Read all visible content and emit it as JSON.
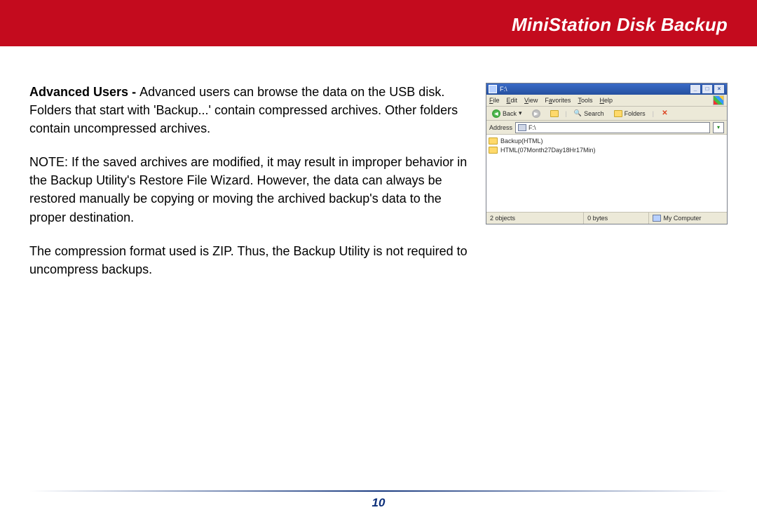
{
  "header": {
    "title": "MiniStation Disk Backup"
  },
  "body": {
    "p1_lead": "Advanced Users - ",
    "p1_rest": "Advanced users can browse the data on the USB disk.  Folders that start with 'Backup...' contain compressed archives.  Other folders contain uncompressed archives.",
    "p2": "NOTE:  If the saved archives are modified, it may result in improper behavior in the Backup Utility's Restore File Wizard.  However, the data can always be restored manually be copying or moving the archived backup's data to the proper destination.",
    "p3": "The compression format used is ZIP.  Thus, the Backup Utility is not required to uncompress backups."
  },
  "explorer": {
    "title": "F:\\",
    "menu": {
      "file": "File",
      "edit": "Edit",
      "view": "View",
      "favorites": "Favorites",
      "tools": "Tools",
      "help": "Help"
    },
    "toolbar": {
      "back": "Back",
      "search": "Search",
      "folders": "Folders"
    },
    "address_label": "Address",
    "address_value": "F:\\",
    "files": [
      {
        "name": "Backup(HTML)"
      },
      {
        "name": "HTML(07Month27Day18Hr17Min)"
      }
    ],
    "status": {
      "objects": "2 objects",
      "bytes": "0 bytes",
      "location": "My Computer"
    }
  },
  "footer": {
    "page": "10"
  }
}
